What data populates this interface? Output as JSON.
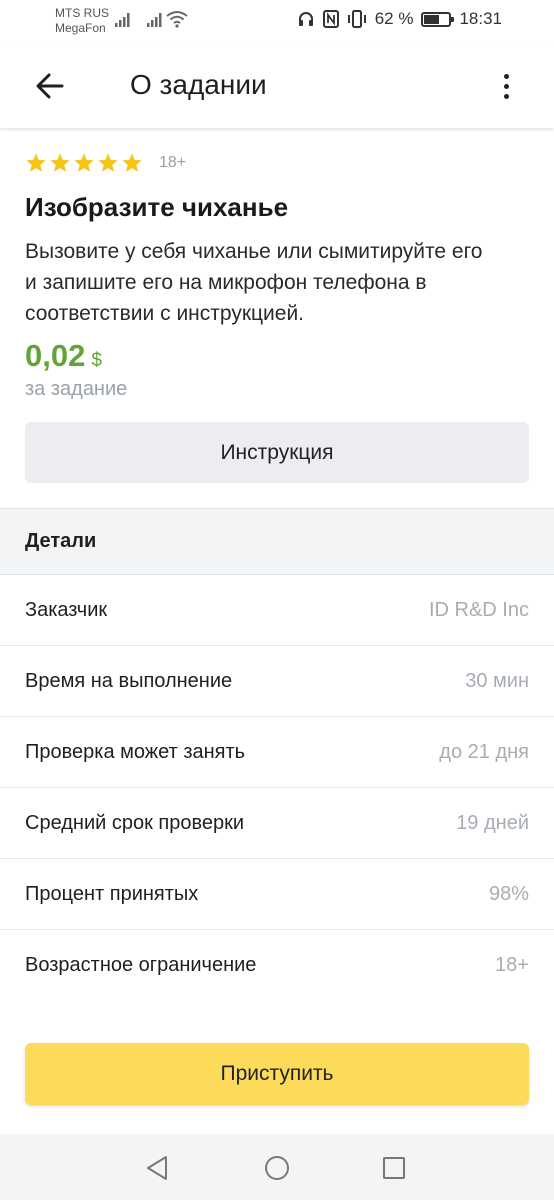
{
  "status_bar": {
    "carrier_1": "MTS RUS",
    "carrier_2": "MegaFon",
    "battery_percent": "62 %",
    "battery_level": 0.62,
    "time": "18:31",
    "icons": [
      "signal-icon",
      "signal-icon",
      "wifi-icon",
      "headphones-icon",
      "nfc-icon",
      "vibrate-icon",
      "battery-icon"
    ]
  },
  "app_bar": {
    "title": "О задании",
    "back_icon": "arrow-left-icon",
    "more_icon": "more-vertical-icon"
  },
  "task": {
    "rating_stars": 5,
    "star_color": "#f5c518",
    "age_limit": "18+",
    "title": "Изобразите чиханье",
    "description": "Вызовите у себя чиханье или сымитируйте его и запишите его на микрофон телефона в соответствии с инструкцией.",
    "price": "0,02",
    "currency": "$",
    "price_caption": "за задание",
    "instruction_button": "Инструкция"
  },
  "details": {
    "header": "Детали",
    "rows": [
      {
        "label": "Заказчик",
        "value": "ID R&D Inc"
      },
      {
        "label": "Время на выполнение",
        "value": "30 мин"
      },
      {
        "label": "Проверка может занять",
        "value": "до 21 дня"
      },
      {
        "label": "Средний срок проверки",
        "value": "19 дней"
      },
      {
        "label": "Процент принятых",
        "value": "98%"
      },
      {
        "label": "Возрастное ограничение",
        "value": "18+"
      }
    ]
  },
  "start_button": "Приступить",
  "colors": {
    "accent_green": "#62a43a",
    "start_button_yellow": "#fcdb5a",
    "secondary_button": "#ebedf0"
  },
  "nav_bar": {
    "icons": [
      "back-triangle-icon",
      "home-circle-icon",
      "recents-square-icon"
    ]
  }
}
